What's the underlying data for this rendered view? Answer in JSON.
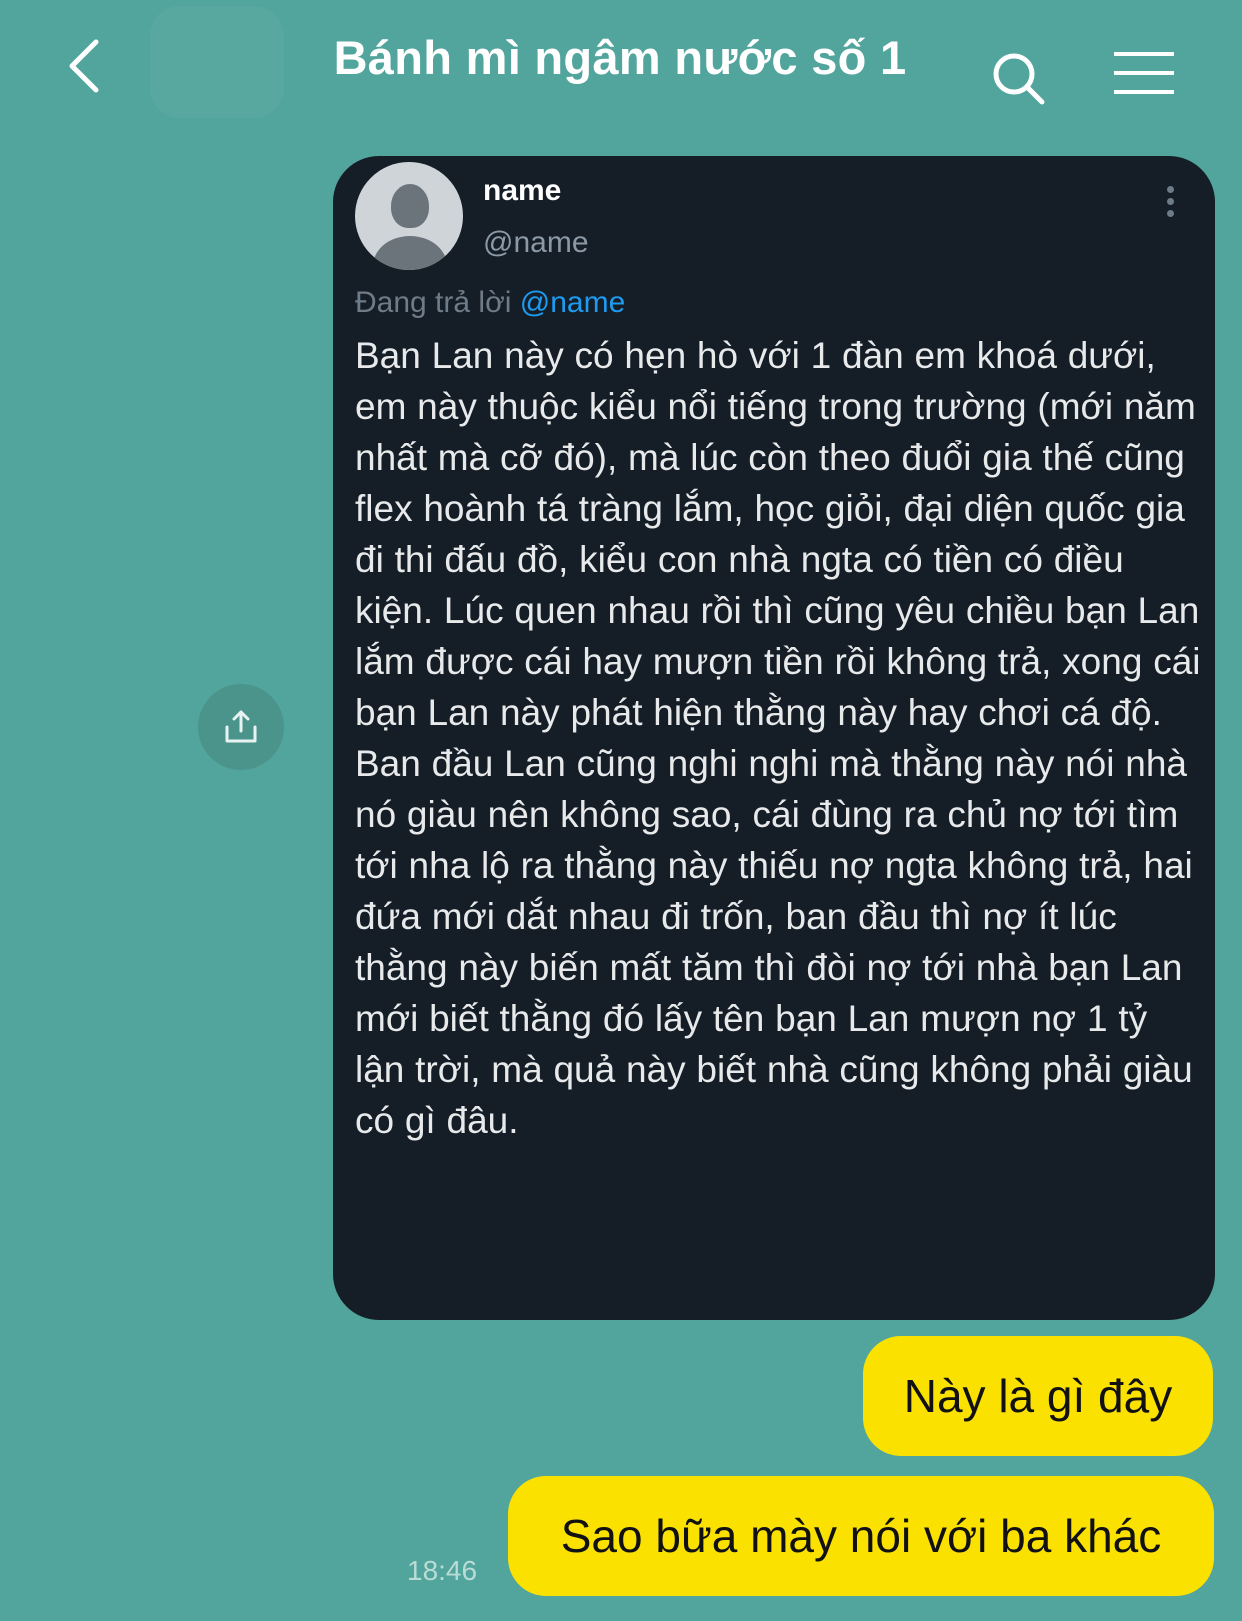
{
  "header": {
    "title": "Bánh mì ngâm nước số 1"
  },
  "tweet": {
    "name": "name",
    "handle": "@name",
    "reply_prefix": "Đang trả lời",
    "reply_mention": "@name",
    "body": "Bạn Lan này có hẹn hò với 1 đàn em khoá dưới, em này thuộc kiểu nổi tiếng trong trường (mới năm nhất mà cỡ đó), mà lúc còn theo đuổi gia thế cũng flex hoành tá tràng lắm, học giỏi, đại diện quốc gia đi thi đấu đồ, kiểu con nhà ngta có tiền có điều kiện. Lúc quen nhau rồi thì cũng yêu chiều bạn Lan lắm được cái hay mượn tiền rồi không trả, xong cái bạn Lan này phát hiện thằng này hay chơi cá độ. Ban đầu Lan cũng nghi nghi mà thằng này nói nhà nó giàu nên không sao, cái đùng ra chủ nợ tới tìm tới nha lộ ra thằng này thiếu nợ ngta không trả, hai đứa mới dắt nhau đi trốn, ban đầu thì nợ ít lúc thằng này biến mất tăm thì đòi nợ tới nhà bạn Lan mới biết thằng đó lấy tên bạn Lan mượn nợ 1 tỷ lận trời, mà quả này biết nhà cũng không phải giàu có gì đâu."
  },
  "messages": [
    {
      "text": "Này là gì đây"
    },
    {
      "text": "Sao bữa mày nói với ba khác"
    }
  ],
  "timestamp": "18:46",
  "icons": [
    "back-arrow-icon",
    "search-icon",
    "menu-icon",
    "share-icon",
    "kebab-icon",
    "default-avatar-icon"
  ],
  "colors": {
    "background": "#52a59c",
    "tweet_card": "#151e27",
    "mention": "#1d9bf0",
    "my_bubble": "#fae100"
  }
}
